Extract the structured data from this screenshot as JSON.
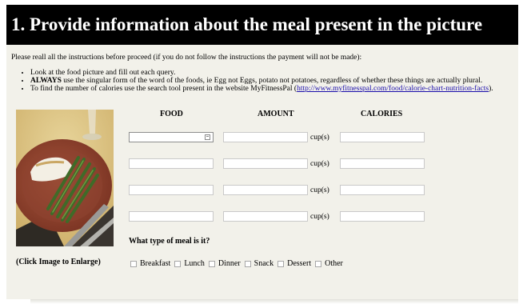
{
  "header": {
    "title": "1. Provide information about the meal present in the picture"
  },
  "intro": "Please reall all the instructions before proceed (if you do not follow the instructions the payment will not be made):",
  "rules": {
    "r1": "Look at the food picture and fill out each query.",
    "r2_bold": "ALWAYS",
    "r2_rest": " use the singular form of the word of the foods, ie Egg not Eggs, potato not potatoes, regardless of whether these things are actually plural.",
    "r3_pre": "To find the number of calories use the search tool present in the website MyFitnessPal (",
    "r3_link": "http://www.myfitnesspal.com/food/calorie-chart-nutrition-facts",
    "r3_post": ")."
  },
  "columns": {
    "food": "FOOD",
    "amount": "AMOUNT",
    "calories": "CALORIES"
  },
  "rows": [
    {
      "food": "",
      "amount": "",
      "unit": "cup(s)",
      "calories": ""
    },
    {
      "food": "",
      "amount": "",
      "unit": "cup(s)",
      "calories": ""
    },
    {
      "food": "",
      "amount": "",
      "unit": "cup(s)",
      "calories": ""
    },
    {
      "food": "",
      "amount": "",
      "unit": "cup(s)",
      "calories": ""
    }
  ],
  "photo_caption": "(Click Image to Enlarge)",
  "meal_question": "What type of meal is it?",
  "meal_options": [
    "Breakfast",
    "Lunch",
    "Dinner",
    "Snack",
    "Dessert",
    "Other"
  ],
  "colors": {
    "header_bg": "#000000",
    "page_bg": "#f2f1ea",
    "link": "#1a0dab"
  }
}
